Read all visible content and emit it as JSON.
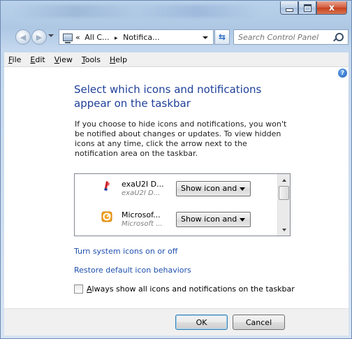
{
  "window": {
    "caption": {
      "minimize": "–",
      "maximize": "□",
      "close": "x"
    }
  },
  "nav": {
    "address_segments": [
      "«",
      "All C...",
      "▸",
      "Notifica..."
    ],
    "search_placeholder": "Search Control Panel"
  },
  "menu": {
    "items": [
      {
        "label": "File",
        "key": "F",
        "rest": "ile"
      },
      {
        "label": "Edit",
        "key": "E",
        "rest": "dit"
      },
      {
        "label": "View",
        "key": "V",
        "rest": "iew"
      },
      {
        "label": "Tools",
        "key": "T",
        "rest": "ools"
      },
      {
        "label": "Help",
        "key": "H",
        "rest": "elp"
      }
    ]
  },
  "main": {
    "help_glyph": "?",
    "heading": "Select which icons and notifications appear on the taskbar",
    "description": "If you choose to hide icons and notifications, you won't be notified about changes or updates. To view hidden icons at any time, click the arrow next to the notification area on the taskbar.",
    "notifications": [
      {
        "name": "exaU2I D...",
        "subtitle": "exaU2I D...",
        "behavior": "Show icon and",
        "icon": "exau2i-app-icon"
      },
      {
        "name": "Microsof...",
        "subtitle": "Microsoft ...",
        "behavior": "Show icon and",
        "icon": "microsoft-app-icon"
      }
    ],
    "link_system_icons": "Turn system icons on or off",
    "link_restore": "Restore default icon behaviors",
    "always_show": {
      "key": "A",
      "rest": "lways show all icons and notifications on the taskbar",
      "checked": false
    }
  },
  "buttons": {
    "ok": "OK",
    "cancel": "Cancel"
  },
  "colors": {
    "heading": "#1e3f9a",
    "link": "#1e4fae",
    "window_frame": "#b9d1ea"
  }
}
